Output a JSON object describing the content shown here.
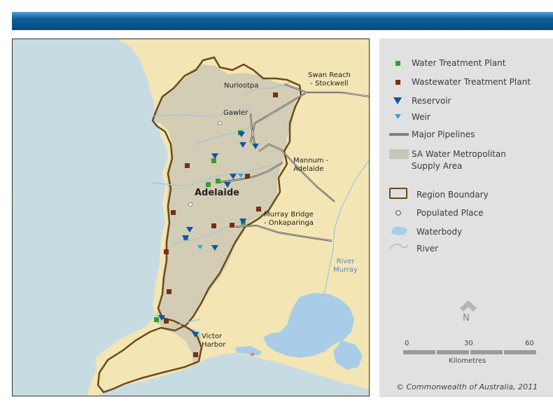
{
  "banner": {},
  "map": {
    "labels": {
      "nuriootpa": "Nuriootpa",
      "gawler": "Gawler",
      "swan_reach": "Swan Reach\n - Stockwell",
      "mannum": "Mannum -\nAdelaide",
      "adelaide": "Adelaide",
      "murray_bridge": "Murray Bridge\n- Onkaparinga",
      "river_murray": "River\nMurray",
      "victor_harbor": "Victor\nHarbor"
    },
    "colors": {
      "sea": "#c7dbe3",
      "land": "#f3e6b4",
      "supply_area": "#d3cdb5",
      "region_boundary": "#6e4a18",
      "water_treatment": "#33a02c",
      "wastewater_treatment": "#7a2e14",
      "reservoir": "#0a56a8",
      "weir": "#2aa7e6",
      "pipeline": "#333333",
      "waterbody": "#a9cde8",
      "river": "#a3c2e0"
    }
  },
  "legend": {
    "items": {
      "water_treatment": "Water Treatment Plant",
      "wastewater_treatment": "Wastewater Treatment Plant",
      "reservoir": "Reservoir",
      "weir": "Weir",
      "pipelines": "Major Pipelines",
      "supply_area": "SA Water Metropolitan\nSupply Area",
      "region_boundary": "Region Boundary",
      "populated_place": "Populated Place",
      "waterbody": "Waterbody",
      "river": "River"
    },
    "north": "N",
    "scale": {
      "ticks": [
        "0",
        "30",
        "60"
      ],
      "unit": "Kilometres"
    },
    "copyright": "© Commonwealth of Australia, 2011"
  }
}
